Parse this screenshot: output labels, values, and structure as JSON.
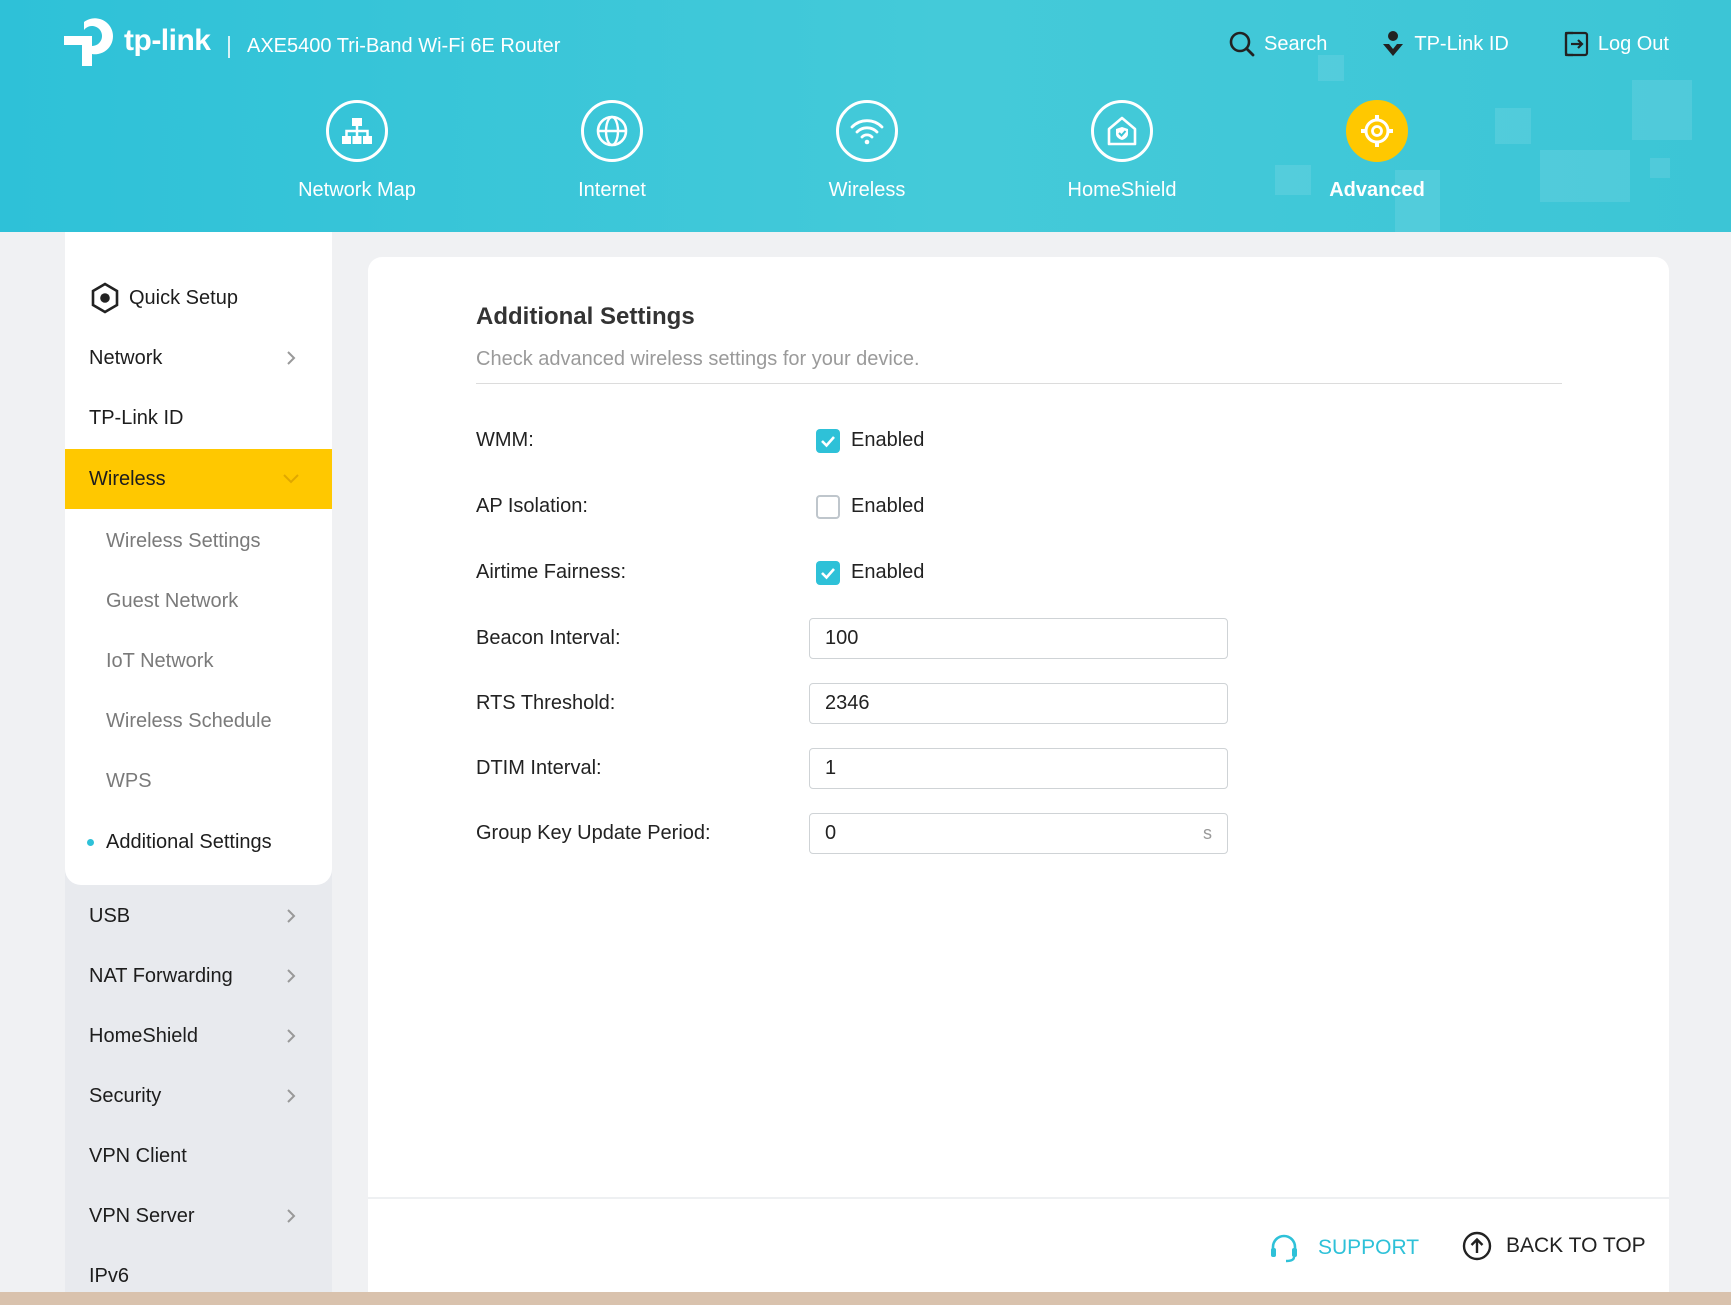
{
  "header": {
    "logo_text": "tp-link",
    "model": "AXE5400 Tri-Band Wi-Fi 6E Router",
    "links": {
      "search": "Search",
      "tplink_id": "TP-Link ID",
      "logout": "Log Out"
    },
    "nav": [
      {
        "label": "Network Map",
        "icon": "network-map-icon"
      },
      {
        "label": "Internet",
        "icon": "globe-icon"
      },
      {
        "label": "Wireless",
        "icon": "wifi-icon"
      },
      {
        "label": "HomeShield",
        "icon": "homeshield-icon"
      },
      {
        "label": "Advanced",
        "icon": "gear-icon",
        "active": true
      }
    ]
  },
  "sidebar": {
    "quick_setup": "Quick Setup",
    "network": "Network",
    "tplink_id": "TP-Link ID",
    "wireless": "Wireless",
    "wireless_sub": [
      {
        "label": "Wireless Settings"
      },
      {
        "label": "Guest Network"
      },
      {
        "label": "IoT Network"
      },
      {
        "label": "Wireless Schedule"
      },
      {
        "label": "WPS"
      },
      {
        "label": "Additional Settings",
        "active": true
      }
    ],
    "usb": "USB",
    "nat_forwarding": "NAT Forwarding",
    "homeshield": "HomeShield",
    "security": "Security",
    "vpn_client": "VPN Client",
    "vpn_server": "VPN Server",
    "ipv6": "IPv6"
  },
  "main": {
    "title": "Additional Settings",
    "subtitle": "Check advanced wireless settings for your device.",
    "wmm": {
      "label": "WMM:",
      "option": "Enabled",
      "checked": true
    },
    "ap_isolation": {
      "label": "AP Isolation:",
      "option": "Enabled",
      "checked": false
    },
    "airtime_fairness": {
      "label": "Airtime Fairness:",
      "option": "Enabled",
      "checked": true
    },
    "beacon_interval": {
      "label": "Beacon Interval:",
      "value": "100"
    },
    "rts_threshold": {
      "label": "RTS Threshold:",
      "value": "2346"
    },
    "dtim_interval": {
      "label": "DTIM Interval:",
      "value": "1"
    },
    "group_key": {
      "label": "Group Key Update Period:",
      "value": "0",
      "unit": "s"
    }
  },
  "footer": {
    "support": "SUPPORT",
    "back_to_top": "BACK TO TOP"
  },
  "colors": {
    "accent": "#2ec1d8",
    "highlight": "#ffc800"
  }
}
